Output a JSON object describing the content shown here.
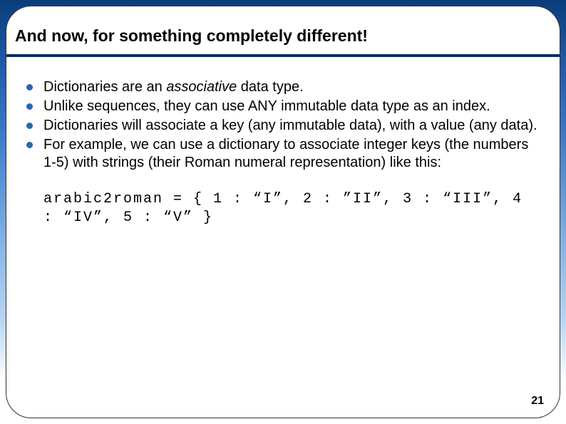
{
  "title": "And now, for something completely different!",
  "bullets": [
    {
      "prefix": "Dictionaries are an ",
      "italic": "associative",
      "suffix": " data type."
    },
    {
      "text": "Unlike sequences, they can use ANY immutable data type as an index."
    },
    {
      "text": "Dictionaries will associate a key (any immutable data), with a value (any data)."
    },
    {
      "text": "For example, we can use a dictionary to associate integer keys (the numbers 1-5) with strings (their Roman numeral representation) like this:"
    }
  ],
  "code": "arabic2roman = { 1 : “I”, 2 : ”II”, 3 : “III”, 4 : “IV”, 5 : “V” }",
  "page_number": "21"
}
